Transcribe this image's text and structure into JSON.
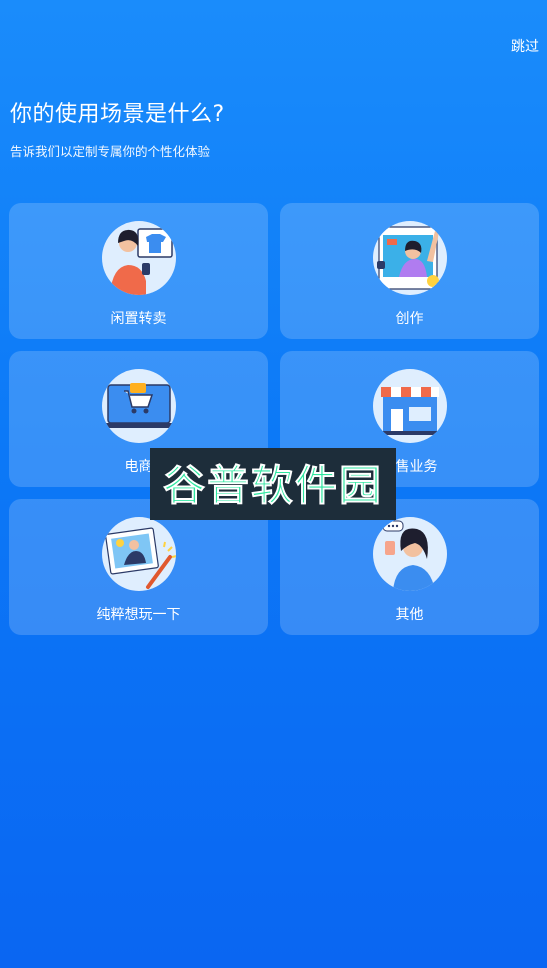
{
  "header": {
    "skip_label": "跳过",
    "title": "你的使用场景是什么?",
    "subtitle": "告诉我们以定制专属你的个性化体验"
  },
  "scenarios": [
    {
      "label": "闲置转卖",
      "icon": "person-selling-clothes-icon"
    },
    {
      "label": "创作",
      "icon": "creator-social-post-icon"
    },
    {
      "label": "电商",
      "icon": "laptop-shopping-cart-icon"
    },
    {
      "label": "零售业务",
      "icon": "storefront-icon"
    },
    {
      "label": "纯粹想玩一下",
      "icon": "photo-magic-wand-icon"
    },
    {
      "label": "其他",
      "icon": "person-chatting-icon"
    }
  ],
  "watermark": {
    "text": "谷普软件园"
  },
  "colors": {
    "background_top": "#1a8cfb",
    "background_bottom": "#0a66f2",
    "watermark_bg": "#1d2d3a",
    "watermark_text": "#2ee6a0"
  }
}
